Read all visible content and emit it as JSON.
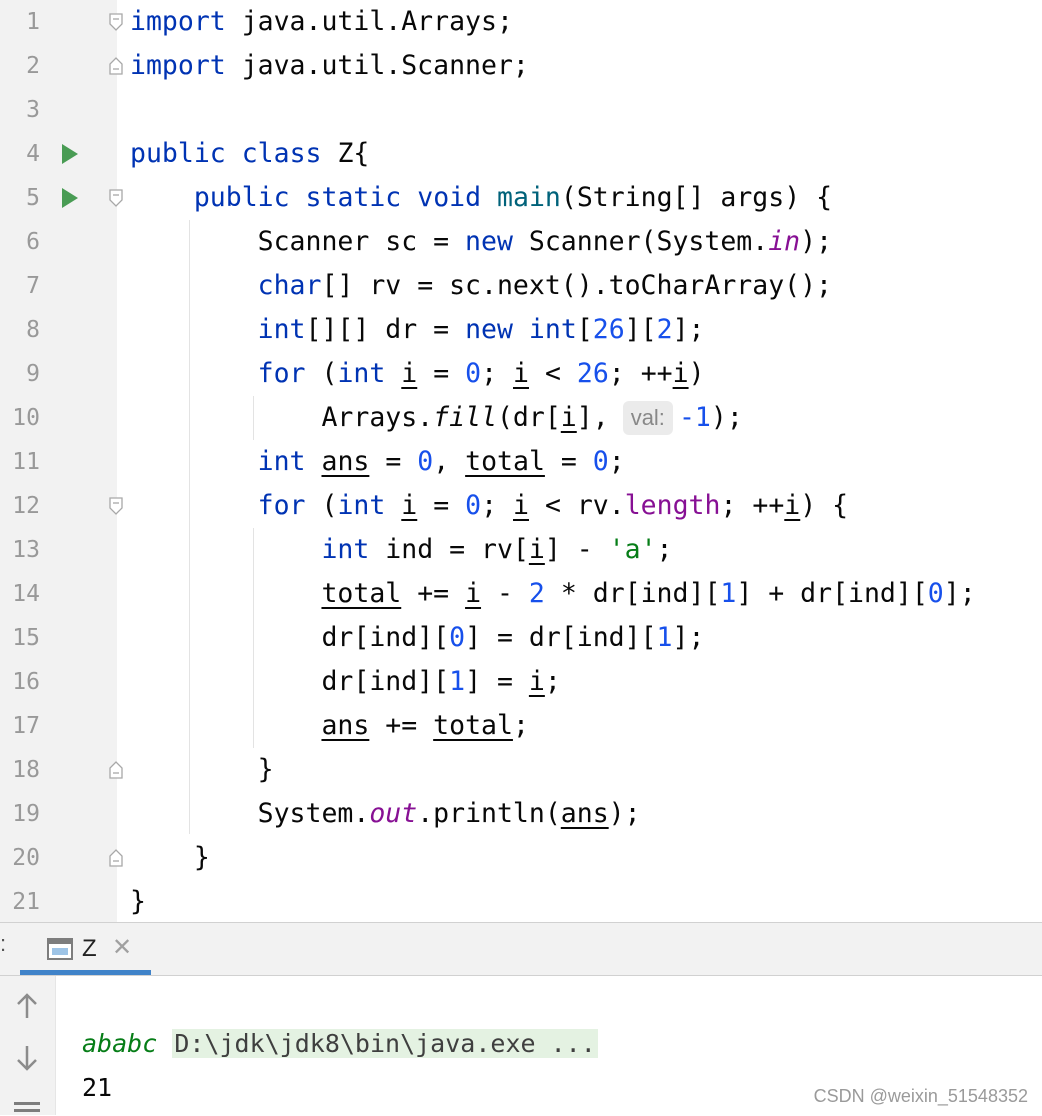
{
  "editor": {
    "line_numbers": [
      "1",
      "2",
      "3",
      "4",
      "5",
      "6",
      "7",
      "8",
      "9",
      "10",
      "11",
      "12",
      "13",
      "14",
      "15",
      "16",
      "17",
      "18",
      "19",
      "20",
      "21"
    ],
    "lines": [
      [
        {
          "t": "import",
          "c": "kw"
        },
        {
          "t": " java.util.Arrays;"
        }
      ],
      [
        {
          "t": "import",
          "c": "kw"
        },
        {
          "t": " java.util.Scanner;"
        }
      ],
      [],
      [
        {
          "t": "public",
          "c": "kw"
        },
        {
          "t": " "
        },
        {
          "t": "class",
          "c": "kw"
        },
        {
          "t": " Z{"
        }
      ],
      [
        {
          "t": "    "
        },
        {
          "t": "public",
          "c": "kw"
        },
        {
          "t": " "
        },
        {
          "t": "static",
          "c": "kw"
        },
        {
          "t": " "
        },
        {
          "t": "void",
          "c": "kw"
        },
        {
          "t": " "
        },
        {
          "t": "main",
          "c": "fn"
        },
        {
          "t": "(String[] args) {"
        }
      ],
      [
        {
          "t": "        Scanner sc = "
        },
        {
          "t": "new",
          "c": "kw"
        },
        {
          "t": " Scanner(System."
        },
        {
          "t": "in",
          "c": "sfld"
        },
        {
          "t": ");"
        }
      ],
      [
        {
          "t": "        "
        },
        {
          "t": "char",
          "c": "kw"
        },
        {
          "t": "[] rv = sc.next().toCharArray();"
        }
      ],
      [
        {
          "t": "        "
        },
        {
          "t": "int",
          "c": "kw"
        },
        {
          "t": "[][] dr = "
        },
        {
          "t": "new",
          "c": "kw"
        },
        {
          "t": " "
        },
        {
          "t": "int",
          "c": "kw"
        },
        {
          "t": "["
        },
        {
          "t": "26",
          "c": "num"
        },
        {
          "t": "]["
        },
        {
          "t": "2",
          "c": "num"
        },
        {
          "t": "];"
        }
      ],
      [
        {
          "t": "        "
        },
        {
          "t": "for",
          "c": "kw"
        },
        {
          "t": " ("
        },
        {
          "t": "int",
          "c": "kw"
        },
        {
          "t": " "
        },
        {
          "t": "i",
          "c": "u"
        },
        {
          "t": " = "
        },
        {
          "t": "0",
          "c": "num"
        },
        {
          "t": "; "
        },
        {
          "t": "i",
          "c": "u"
        },
        {
          "t": " < "
        },
        {
          "t": "26",
          "c": "num"
        },
        {
          "t": "; ++"
        },
        {
          "t": "i",
          "c": "u"
        },
        {
          "t": ")"
        }
      ],
      [
        {
          "t": "            Arrays."
        },
        {
          "t": "fill",
          "c": "it"
        },
        {
          "t": "(dr["
        },
        {
          "t": "i",
          "c": "u"
        },
        {
          "t": "],"
        },
        {
          "t": "val:",
          "c": "hint"
        },
        {
          "t": "-1",
          "c": "num"
        },
        {
          "t": ");"
        }
      ],
      [
        {
          "t": "        "
        },
        {
          "t": "int",
          "c": "kw"
        },
        {
          "t": " "
        },
        {
          "t": "ans",
          "c": "u"
        },
        {
          "t": " = "
        },
        {
          "t": "0",
          "c": "num"
        },
        {
          "t": ", "
        },
        {
          "t": "total",
          "c": "u"
        },
        {
          "t": " = "
        },
        {
          "t": "0",
          "c": "num"
        },
        {
          "t": ";"
        }
      ],
      [
        {
          "t": "        "
        },
        {
          "t": "for",
          "c": "kw"
        },
        {
          "t": " ("
        },
        {
          "t": "int",
          "c": "kw"
        },
        {
          "t": " "
        },
        {
          "t": "i",
          "c": "u"
        },
        {
          "t": " = "
        },
        {
          "t": "0",
          "c": "num"
        },
        {
          "t": "; "
        },
        {
          "t": "i",
          "c": "u"
        },
        {
          "t": " < rv."
        },
        {
          "t": "length",
          "c": "fld"
        },
        {
          "t": "; ++"
        },
        {
          "t": "i",
          "c": "u"
        },
        {
          "t": ") {"
        }
      ],
      [
        {
          "t": "            "
        },
        {
          "t": "int",
          "c": "kw"
        },
        {
          "t": " ind = rv["
        },
        {
          "t": "i",
          "c": "u"
        },
        {
          "t": "] - "
        },
        {
          "t": "'a'",
          "c": "str"
        },
        {
          "t": ";"
        }
      ],
      [
        {
          "t": "            "
        },
        {
          "t": "total",
          "c": "u"
        },
        {
          "t": " += "
        },
        {
          "t": "i",
          "c": "u"
        },
        {
          "t": " - "
        },
        {
          "t": "2",
          "c": "num"
        },
        {
          "t": " * dr[ind]["
        },
        {
          "t": "1",
          "c": "num"
        },
        {
          "t": "] + dr[ind]["
        },
        {
          "t": "0",
          "c": "num"
        },
        {
          "t": "];"
        }
      ],
      [
        {
          "t": "            dr[ind]["
        },
        {
          "t": "0",
          "c": "num"
        },
        {
          "t": "] = dr[ind]["
        },
        {
          "t": "1",
          "c": "num"
        },
        {
          "t": "];"
        }
      ],
      [
        {
          "t": "            dr[ind]["
        },
        {
          "t": "1",
          "c": "num"
        },
        {
          "t": "] = "
        },
        {
          "t": "i",
          "c": "u"
        },
        {
          "t": ";"
        }
      ],
      [
        {
          "t": "            "
        },
        {
          "t": "ans",
          "c": "u"
        },
        {
          "t": " += "
        },
        {
          "t": "total",
          "c": "u"
        },
        {
          "t": ";"
        }
      ],
      [
        {
          "t": "        }"
        }
      ],
      [
        {
          "t": "        System."
        },
        {
          "t": "out",
          "c": "sfld"
        },
        {
          "t": ".println("
        },
        {
          "t": "ans",
          "c": "u"
        },
        {
          "t": ");"
        }
      ],
      [
        {
          "t": "    }"
        }
      ],
      [
        {
          "t": "}"
        }
      ]
    ],
    "run_gutter_lines": [
      4,
      5
    ],
    "fold_start_lines": [
      1,
      5,
      12
    ],
    "fold_end_lines": [
      2,
      18,
      20
    ]
  },
  "run_panel": {
    "left_edge_label": ":",
    "tab_label": "Z",
    "console": {
      "command": "D:\\jdk\\jdk8\\bin\\java.exe ...",
      "input_echo": "ababc",
      "output": "21"
    }
  },
  "watermark": "CSDN @weixin_51548352",
  "colors": {
    "keyword": "#0033b3",
    "number": "#1750eb",
    "string": "#067d17",
    "field": "#871094",
    "method_declaration": "#00627a",
    "user_input": "#067d17",
    "run_icon": "#499c54",
    "tab_underline": "#4083c9",
    "command_highlight": "#e4f2e2"
  }
}
